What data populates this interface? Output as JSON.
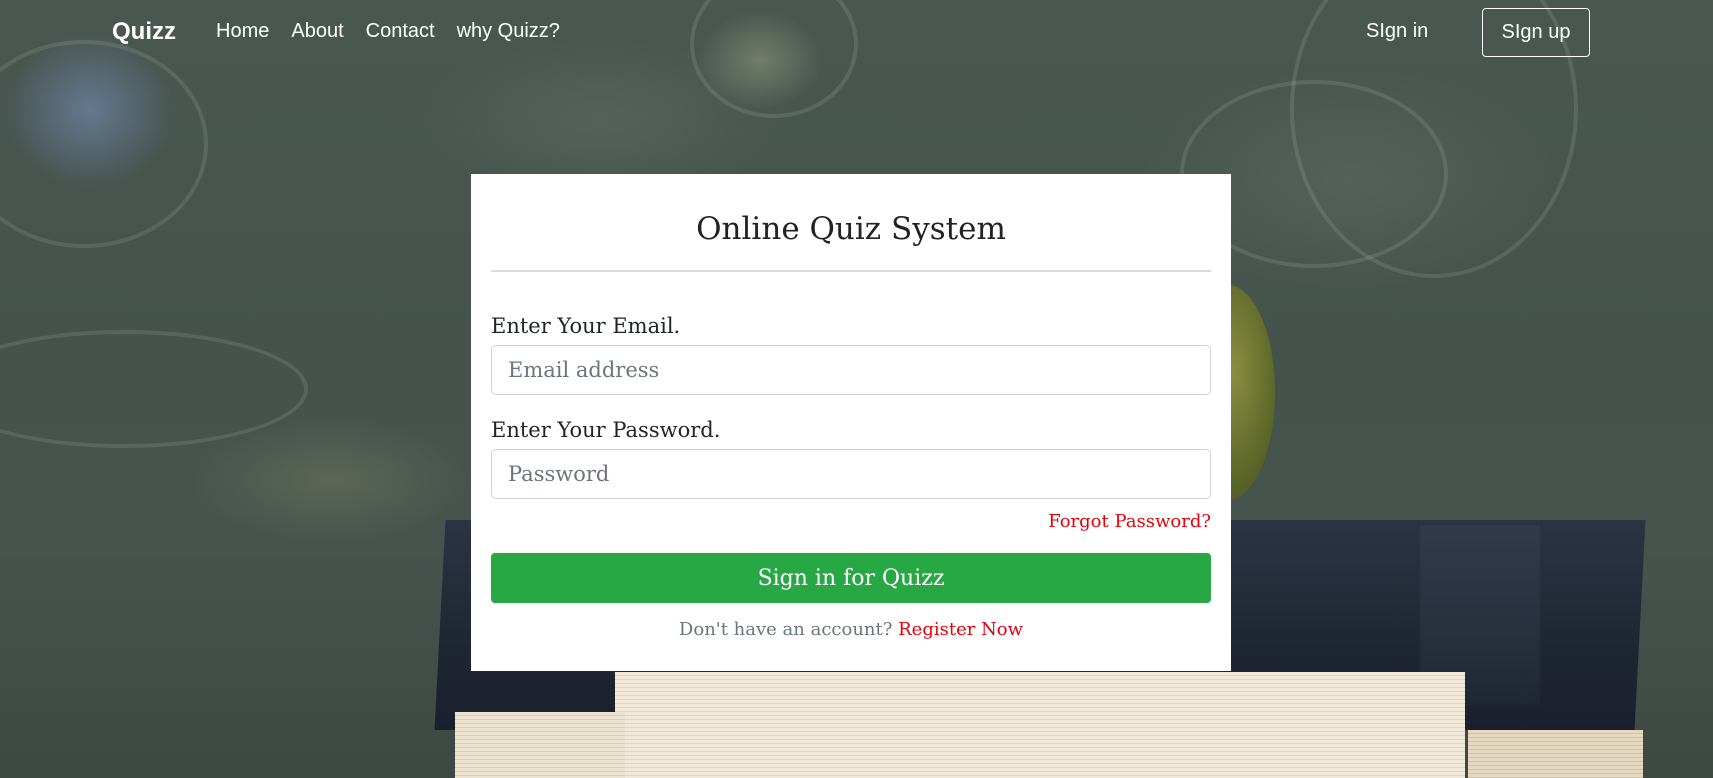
{
  "navbar": {
    "brand": "Quizz",
    "links": [
      {
        "label": "Home"
      },
      {
        "label": "About"
      },
      {
        "label": "Contact"
      },
      {
        "label": "why Quizz?"
      }
    ],
    "signin_label": "SIgn in",
    "signup_label": "SIgn up"
  },
  "login_card": {
    "title": "Online Quiz System",
    "email": {
      "label": "Enter Your Email.",
      "placeholder": "Email address",
      "value": ""
    },
    "password": {
      "label": "Enter Your Password.",
      "placeholder": "Password",
      "value": ""
    },
    "forgot_label": "Forgot Password?",
    "submit_label": "Sign in for Quizz",
    "register_prompt": "Don't have an account?",
    "register_label": "Register Now"
  },
  "colors": {
    "accent_green": "#28a745",
    "link_red": "#e8000b",
    "card_background": "#ffffff",
    "chalkboard": "#46534c"
  }
}
